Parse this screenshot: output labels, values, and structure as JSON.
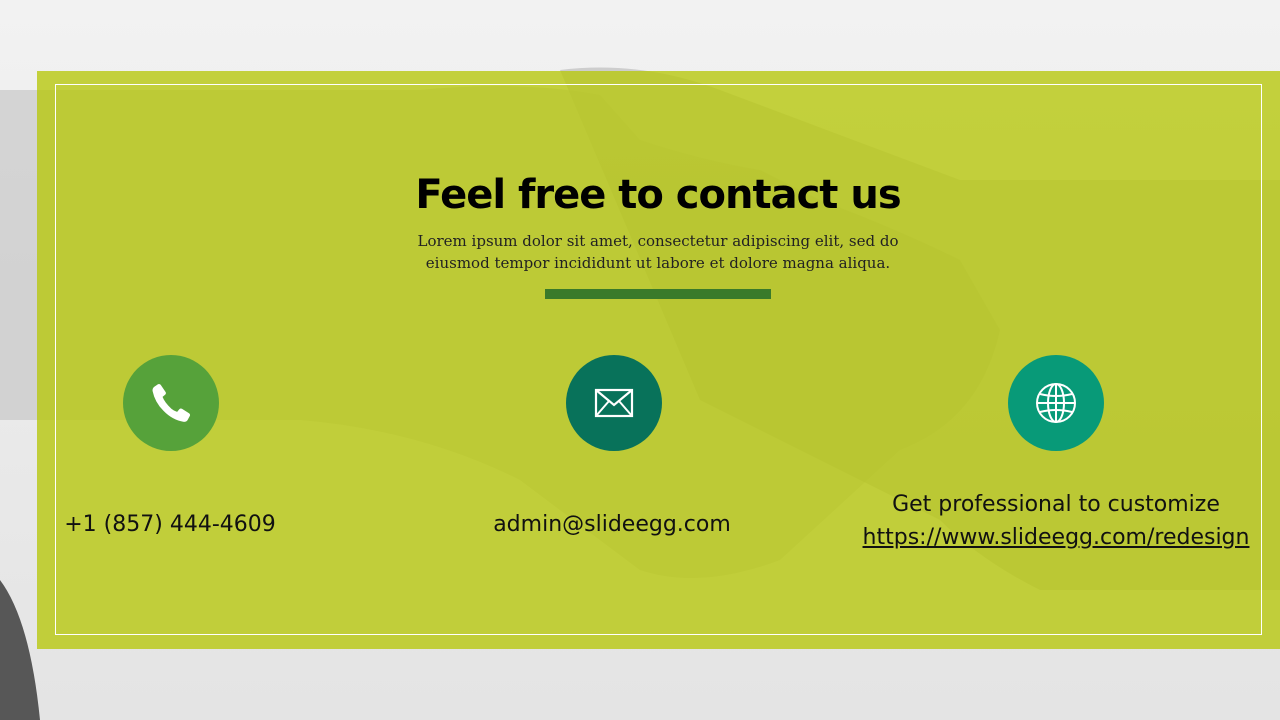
{
  "slide": {
    "title": "Feel free to contact us",
    "subtitle_line1": "Lorem ipsum dolor sit amet, consectetur adipiscing elit, sed do",
    "subtitle_line2": "eiusmod tempor incididunt ut labore et dolore magna aliqua.",
    "overlay_color": "#b8c814",
    "divider_color": "#3a7a2a"
  },
  "contacts": {
    "phone": {
      "icon": "phone-icon",
      "text": "+1 (857) 444-4609",
      "color": "#56a23a"
    },
    "email": {
      "icon": "envelope-icon",
      "text": "admin@slideegg.com",
      "color": "#08725a"
    },
    "web": {
      "icon": "globe-icon",
      "line1": "Get professional to customize",
      "link": "https://www.slideegg.com/redesign",
      "color": "#089a78"
    }
  }
}
